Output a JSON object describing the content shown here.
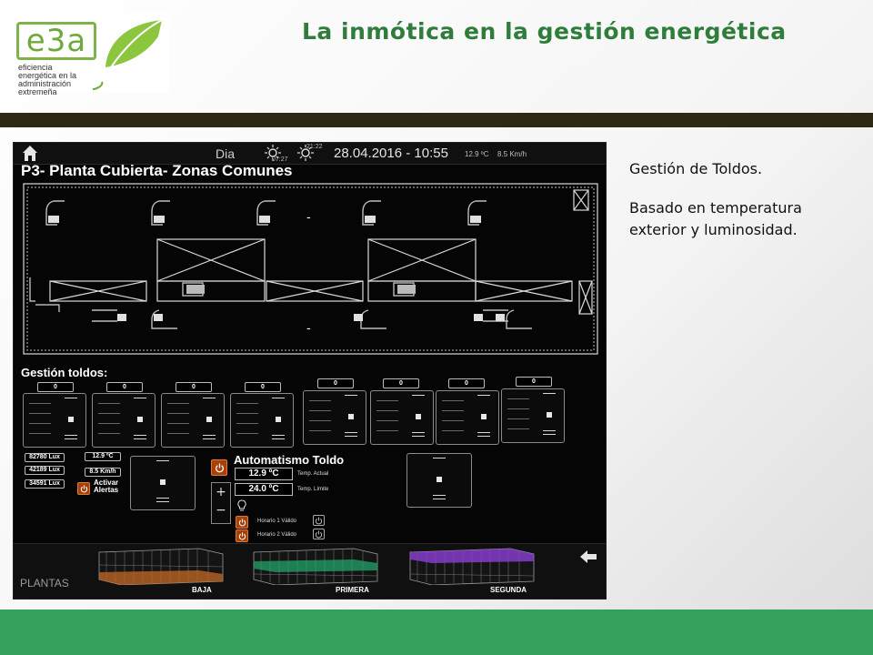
{
  "slide": {
    "title": "La inmótica en la gestión energética",
    "logo": {
      "brand": "e3a",
      "tagline_1": "eficiencia",
      "tagline_2": "energética en la",
      "tagline_3": "administración",
      "tagline_4": "extremeña",
      "color": "#6fa93c"
    },
    "text_1": "Gestión de Toldos.",
    "text_2_line1": "Basado en temperatura",
    "text_2_line2": "exterior y luminosidad.",
    "colors": {
      "title": "#2e7d3b",
      "top_band": "#2c2a14",
      "bottom_band": "#35a15a"
    }
  },
  "screen": {
    "status": {
      "mode": "Dia",
      "sunrise": "07:27",
      "sunset": "21:22",
      "datetime": "28.04.2016 - 10:55",
      "temperature": "12.9 ºC",
      "wind": "8.5 Km/h"
    },
    "zone_title": "P3- Planta Cubierta- Zonas Comunes",
    "plan_marks": [
      "-",
      "-"
    ],
    "section_title": "Gestión toldos:",
    "awnings": [
      {
        "value": "0"
      },
      {
        "value": "0"
      },
      {
        "value": "0"
      },
      {
        "value": "0"
      },
      {
        "value": "0"
      },
      {
        "value": "0"
      },
      {
        "value": "0"
      },
      {
        "value": "0"
      }
    ],
    "sensors": {
      "lux_1": "82780 Lux",
      "lux_2": "42189 Lux",
      "lux_3": "34591 Lux",
      "temperature": "12.9 ºC",
      "wind": "8.5 Km/h",
      "alert_line1": "Activar",
      "alert_line2": "Alertas"
    },
    "automation": {
      "title": "Automatismo Toldo",
      "temp_actual": "12.9 ºC",
      "temp_actual_label": "Temp. Actual",
      "temp_limit": "24.0 ºC",
      "temp_limit_label": "Temp. Límite",
      "plus": "+",
      "minus": "−",
      "schedule_1": "Horario 1 Válido",
      "schedule_2": "Horario 2 Válido"
    },
    "floors": {
      "section_label": "PLANTAS",
      "items": [
        {
          "label": "BAJA",
          "color": "#c46a24"
        },
        {
          "label": "PRIMERA",
          "color": "#22a36a"
        },
        {
          "label": "SEGUNDA",
          "color": "#8c3fd6"
        }
      ]
    },
    "colors": {
      "background": "#050505",
      "accent_orange": "#a8400c"
    }
  }
}
